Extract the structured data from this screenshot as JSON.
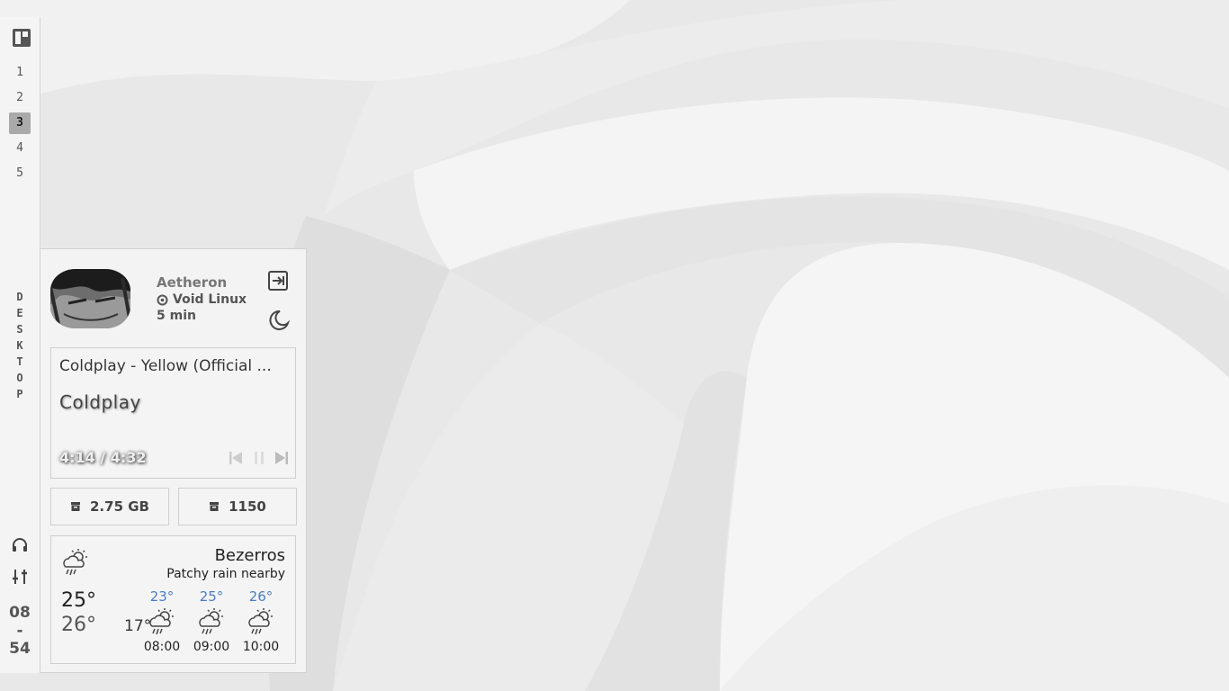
{
  "sidebar": {
    "workspaces": [
      "1",
      "2",
      "3",
      "4",
      "5"
    ],
    "active_workspace": "3",
    "vertical_label": [
      "D",
      "E",
      "S",
      "K",
      "T",
      "O",
      "P"
    ],
    "clock_hour": "08",
    "clock_sep": "-",
    "clock_min": "54",
    "icons": [
      "layout-icon",
      "headphones-icon",
      "sliders-icon"
    ]
  },
  "profile": {
    "name": "Aetheron",
    "os": "Void Linux",
    "uptime": "5 min"
  },
  "media": {
    "title": "Coldplay - Yellow (Official ...",
    "artist": "Coldplay",
    "time": "4:14 / 4:32"
  },
  "stats": {
    "memory": "2.75 GB",
    "packages": "1150"
  },
  "weather": {
    "city": "Bezerros",
    "description": "Patchy rain nearby",
    "current_temp": "25°",
    "high": "26°",
    "low": "17°",
    "forecast": [
      {
        "temp": "23°",
        "hour": "08:00"
      },
      {
        "temp": "25°",
        "hour": "09:00"
      },
      {
        "temp": "26°",
        "hour": "10:00"
      }
    ],
    "forecast_color": "#4a7cc0"
  }
}
